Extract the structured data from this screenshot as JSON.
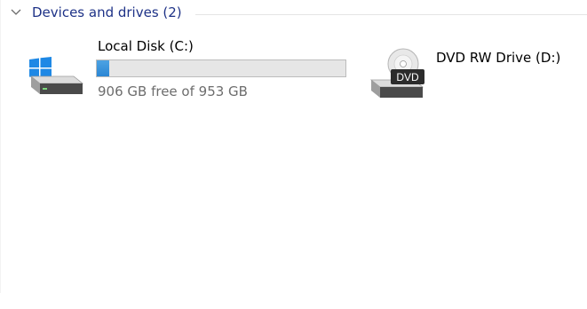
{
  "group": {
    "title": "Devices and drives (2)",
    "icon": "chevron-down-icon"
  },
  "drives": [
    {
      "name": "Local Disk (C:)",
      "icon": "windows-hard-drive-icon",
      "free_text": "906 GB free of 953 GB",
      "used_fraction": 0.049,
      "bar_color": "#2b86d4"
    },
    {
      "name": "DVD RW Drive (D:)",
      "icon": "dvd-drive-icon",
      "disc_label": "DVD"
    }
  ]
}
